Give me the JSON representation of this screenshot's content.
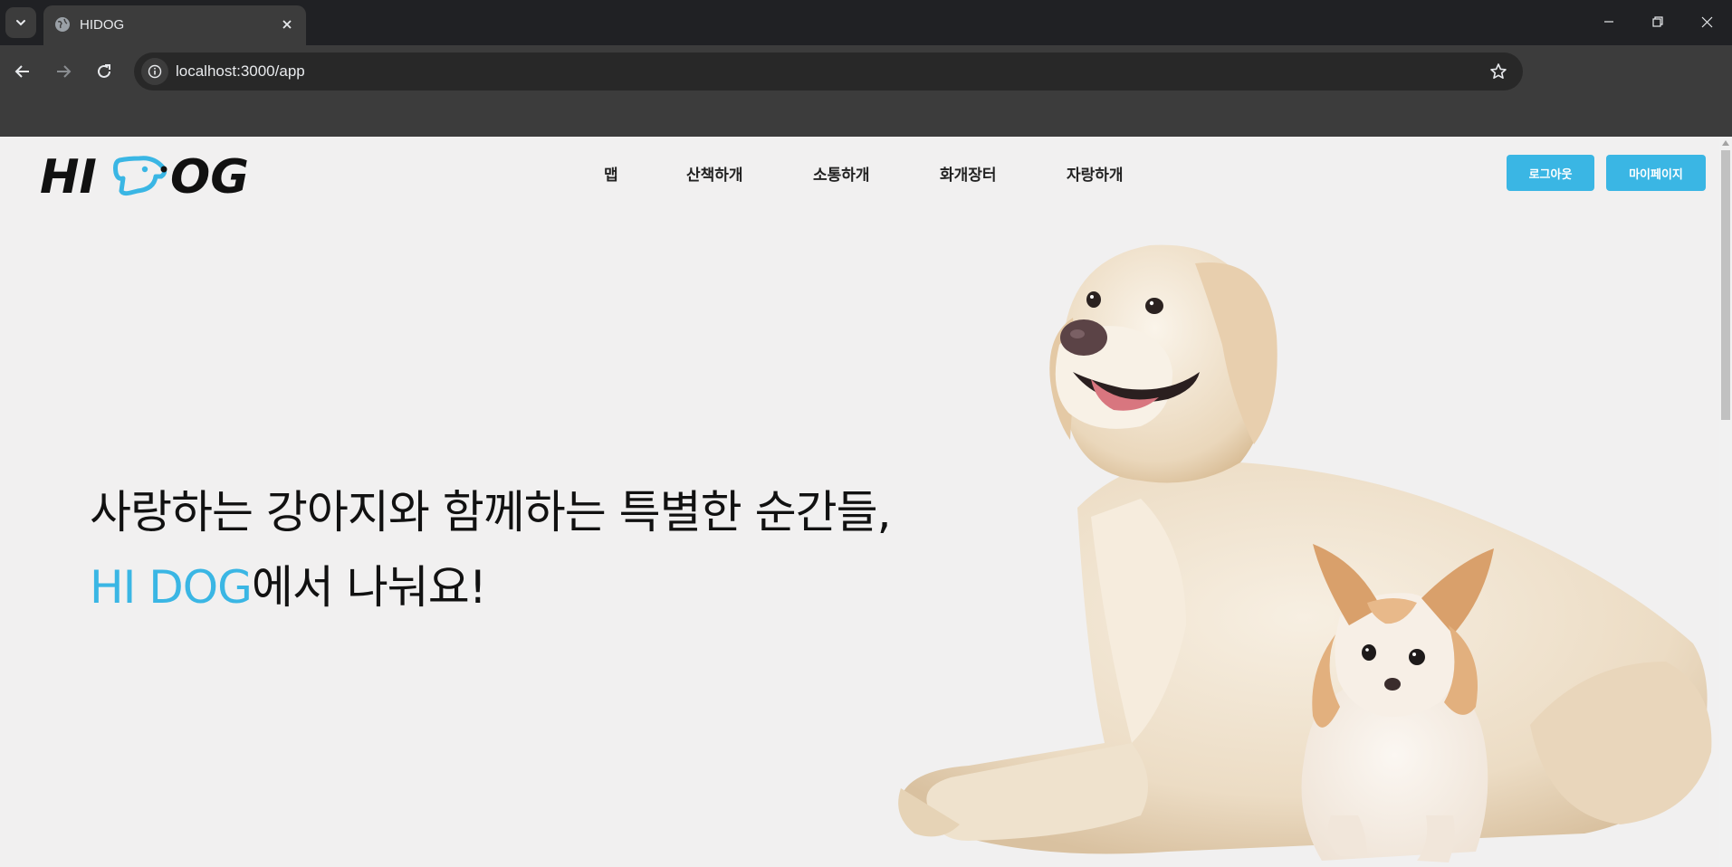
{
  "browser": {
    "tab_title": "HIDOG",
    "url": "localhost:3000/app"
  },
  "site": {
    "logo_text": "HI DOG",
    "nav": [
      {
        "label": "맵"
      },
      {
        "label": "산책하개"
      },
      {
        "label": "소통하개"
      },
      {
        "label": "화개장터"
      },
      {
        "label": "자랑하개"
      }
    ],
    "logout_label": "로그아웃",
    "mypage_label": "마이페이지"
  },
  "hero": {
    "line1": "사랑하는 강아지와 함께하는 특별한 순간들,",
    "line2_brand": "HI DOG",
    "line2_rest": "에서 나눠요!"
  },
  "colors": {
    "accent": "#3ab6e4",
    "page_bg": "#f1f0f0",
    "chrome_dark": "#202124",
    "chrome_toolbar": "#3c3c3c"
  }
}
